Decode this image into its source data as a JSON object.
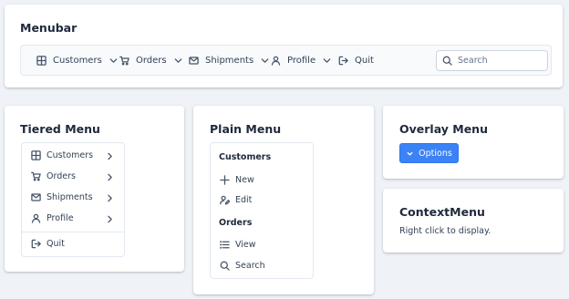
{
  "menubar": {
    "title": "Menubar",
    "items": [
      {
        "label": "Customers",
        "icon": "table-icon"
      },
      {
        "label": "Orders",
        "icon": "cart-icon"
      },
      {
        "label": "Shipments",
        "icon": "envelope-icon"
      },
      {
        "label": "Profile",
        "icon": "user-icon"
      },
      {
        "label": "Quit",
        "icon": "sign-out-icon"
      }
    ],
    "search_placeholder": "Search"
  },
  "tiered": {
    "title": "Tiered Menu",
    "items": [
      {
        "label": "Customers",
        "icon": "table-icon"
      },
      {
        "label": "Orders",
        "icon": "cart-icon"
      },
      {
        "label": "Shipments",
        "icon": "envelope-icon"
      },
      {
        "label": "Profile",
        "icon": "user-icon"
      },
      {
        "label": "Quit",
        "icon": "sign-out-icon"
      }
    ]
  },
  "plain": {
    "title": "Plain Menu",
    "groups": [
      {
        "label": "Customers",
        "items": [
          {
            "label": "New",
            "icon": "plus-icon"
          },
          {
            "label": "Edit",
            "icon": "user-edit-icon"
          }
        ]
      },
      {
        "label": "Orders",
        "items": [
          {
            "label": "View",
            "icon": "list-icon"
          },
          {
            "label": "Search",
            "icon": "search-icon"
          }
        ]
      }
    ]
  },
  "overlay": {
    "title": "Overlay Menu",
    "button_label": "Options"
  },
  "context": {
    "title": "ContextMenu",
    "text": "Right click to display."
  },
  "colors": {
    "background": "#eff3f8",
    "card": "#ffffff",
    "accent": "#3b82f6"
  }
}
